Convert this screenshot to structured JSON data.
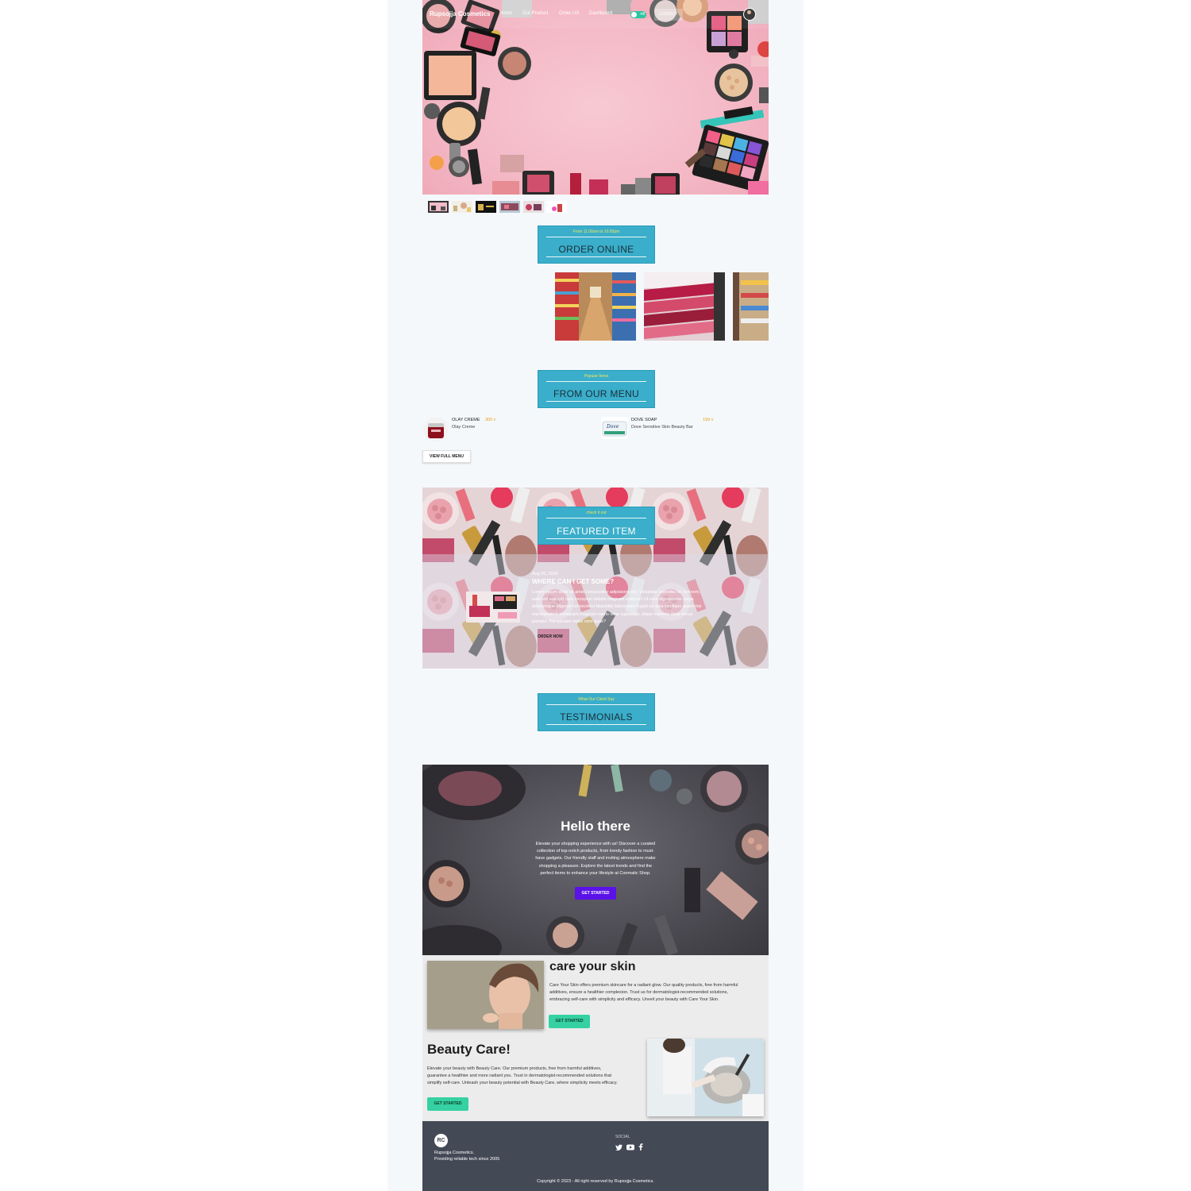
{
  "nav": {
    "brand": "Rupsojja Cosmetics",
    "links": [
      "Home",
      "Our Product",
      "Order US",
      "Dashboard"
    ],
    "cart_count": "+0",
    "logout": "LOGOUT"
  },
  "order_section": {
    "subtitle": "From 11.00am to 10.00pm",
    "title": "ORDER ONLINE"
  },
  "menu_section": {
    "subtitle": "Popular Items",
    "title": "FROM OUR MENU",
    "items": [
      {
        "name": "OLAY CREME",
        "price": "300 ৳",
        "desc": "Olay Creme"
      },
      {
        "name": "DOVE SOAP",
        "price": "199 ৳",
        "desc": "Dove Sensitive Skin Beauty Bar"
      }
    ],
    "view_full_menu": "VIEW FULL MENU"
  },
  "featured": {
    "subtitle": "check it out",
    "title": "FEATURED ITEM",
    "date": "Aug 20, 2029",
    "heading": "WHERE CAN I GET SOME?",
    "body_lines": [
      "Lorem ipsum dolor sit amet consectetur adipisicing elit. Voluptate expedita hic dolorem,",
      "iusto vel suscipit nam excepturi debitis magnam nostrum! Ut eum dignissimos culpa",
      "doloremque eligendi consectetur blanditiis laboriosam fugiat ea quia similique quam nisi",
      "reprehenderit numquam magnam nemo vitae cupiditate, atque maiores dicta minus",
      "pariatur. Perspiciatis nobis vero quas?"
    ],
    "cta": "ORDER NOW"
  },
  "testimonials": {
    "subtitle": "What Our Client Say",
    "title": "TESTIMONIALS"
  },
  "hello": {
    "title": "Hello there",
    "body_lines": [
      "Elevate your shopping experience with us! Discover a curated",
      "collection of top-notch products, from trendy fashion to must-",
      "have gadgets. Our friendly staff and inviting atmosphere make",
      "shopping a pleasure. Explore the latest trends and find the",
      "perfect items to enhance your lifestyle at Conmatic Shop."
    ],
    "cta": "GET STARTED"
  },
  "care": {
    "title": "care your skin",
    "body_lines": [
      "Care Your Skin offers premium skincare for a radiant glow. Our quality products, free from harmful",
      "additives, ensure a healthier complexion. Trust us for dermatologist-recommended solutions,",
      "embracing self-care with simplicity and efficacy. Unveil your beauty with Care Your Skin."
    ],
    "cta": "GET STARTED"
  },
  "beauty": {
    "title": "Beauty Care!",
    "body_lines": [
      "Elevate your beauty with Beauty Care. Our premium products, free from harmful additives,",
      "guarantee a healthier and more radiant you. Trust in dermatologist-recommended solutions that",
      "simplify self-care. Unleash your beauty potential with Beauty Care, where simplicity meets efficacy."
    ],
    "cta": "GET STARTED"
  },
  "footer": {
    "logo_text": "RC",
    "company": "Rupsojja Cosmetics.",
    "tagline": "Providing reliable tech since 2005",
    "social_label": "SOCIAL",
    "copyright": "Copyright © 2023 - All right reserved by Rupsojja Cosmetics."
  },
  "colors": {
    "section_title_bg": "#3aaeca",
    "section_subtitle": "#f3e65b",
    "price": "#e0a21c",
    "primary_button": "#5a12e8",
    "green_button": "#35d1a2",
    "footer_bg": "#434955"
  }
}
